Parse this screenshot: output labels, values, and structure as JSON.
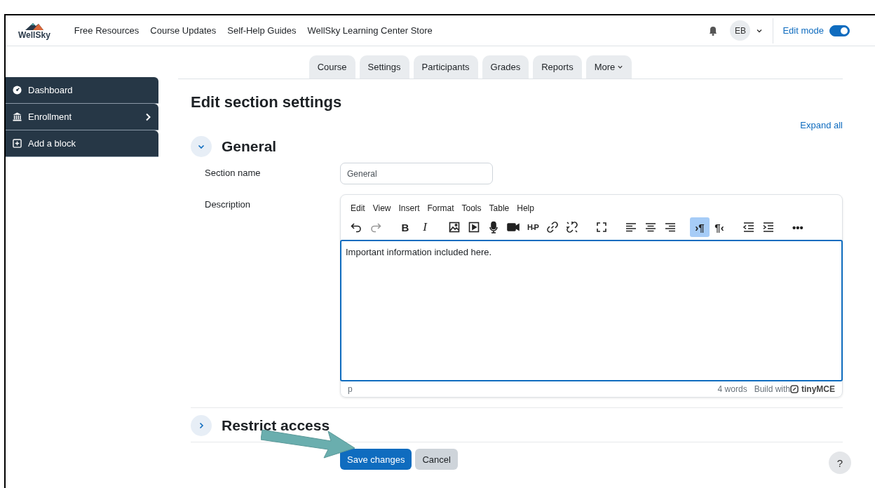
{
  "header": {
    "logo_text": "WellSky",
    "nav_links": [
      "Free Resources",
      "Course Updates",
      "Self-Help Guides",
      "WellSky Learning Center Store"
    ],
    "avatar_initials": "EB",
    "edit_mode": {
      "label": "Edit mode",
      "on": true
    }
  },
  "course_tabs": [
    {
      "label": "Course",
      "selected": false
    },
    {
      "label": "Settings",
      "selected": false
    },
    {
      "label": "Participants",
      "selected": false
    },
    {
      "label": "Grades",
      "selected": false
    },
    {
      "label": "Reports",
      "selected": false
    },
    {
      "label": "More",
      "selected": false
    }
  ],
  "sidebar": {
    "items": [
      {
        "kind": "dashboard",
        "label": "Dashboard"
      },
      {
        "kind": "enrollment",
        "label": "Enrollment"
      },
      {
        "kind": "add",
        "label": "Add a block"
      }
    ]
  },
  "page_title": "Edit section settings",
  "expand_all": "Expand all",
  "sections": [
    {
      "title": "General",
      "expanded": true
    },
    {
      "title": "Restrict access",
      "expanded": false
    }
  ],
  "form": {
    "section_name": {
      "label": "Section name",
      "value": "General"
    },
    "description": {
      "label": "Description",
      "menubar": [
        "Edit",
        "View",
        "Insert",
        "Format",
        "Tools",
        "Table",
        "Help"
      ],
      "toolbar": [
        {
          "kind": "undo",
          "selected": false,
          "disabled": false
        },
        {
          "kind": "redo",
          "selected": false,
          "disabled": true
        },
        {
          "kind": "bold",
          "label": "B",
          "selected": false,
          "disabled": false
        },
        {
          "kind": "italic",
          "label": "I",
          "selected": false,
          "disabled": false
        },
        {
          "kind": "image",
          "selected": false,
          "disabled": false
        },
        {
          "kind": "media",
          "selected": false,
          "disabled": false
        },
        {
          "kind": "mic",
          "selected": false,
          "disabled": false
        },
        {
          "kind": "video",
          "selected": false,
          "disabled": false
        },
        {
          "kind": "h5p",
          "label": "H-P",
          "selected": false,
          "disabled": false
        },
        {
          "kind": "link",
          "selected": false,
          "disabled": false
        },
        {
          "kind": "unlink",
          "selected": false,
          "disabled": false
        },
        {
          "kind": "fullscreen",
          "selected": false,
          "disabled": false
        },
        {
          "kind": "align-left",
          "selected": false,
          "disabled": false
        },
        {
          "kind": "align-center",
          "selected": false,
          "disabled": false
        },
        {
          "kind": "align-right",
          "selected": false,
          "disabled": false
        },
        {
          "kind": "ltr",
          "label": "›¶",
          "selected": true,
          "disabled": false
        },
        {
          "kind": "rtl",
          "label": "¶‹",
          "selected": false,
          "disabled": false
        },
        {
          "kind": "outdent",
          "selected": false,
          "disabled": false
        },
        {
          "kind": "indent",
          "selected": false,
          "disabled": false
        },
        {
          "kind": "more",
          "label": "•••",
          "selected": false,
          "disabled": false
        }
      ],
      "content": "Important information included here.",
      "path": "p",
      "word_count": "4 words",
      "branding_prefix": "Build with",
      "branding_name": "tinyMCE"
    }
  },
  "buttons": [
    {
      "label": "Save changes",
      "kind": "primary"
    },
    {
      "label": "Cancel",
      "kind": "secondary"
    }
  ],
  "help_button": "?"
}
